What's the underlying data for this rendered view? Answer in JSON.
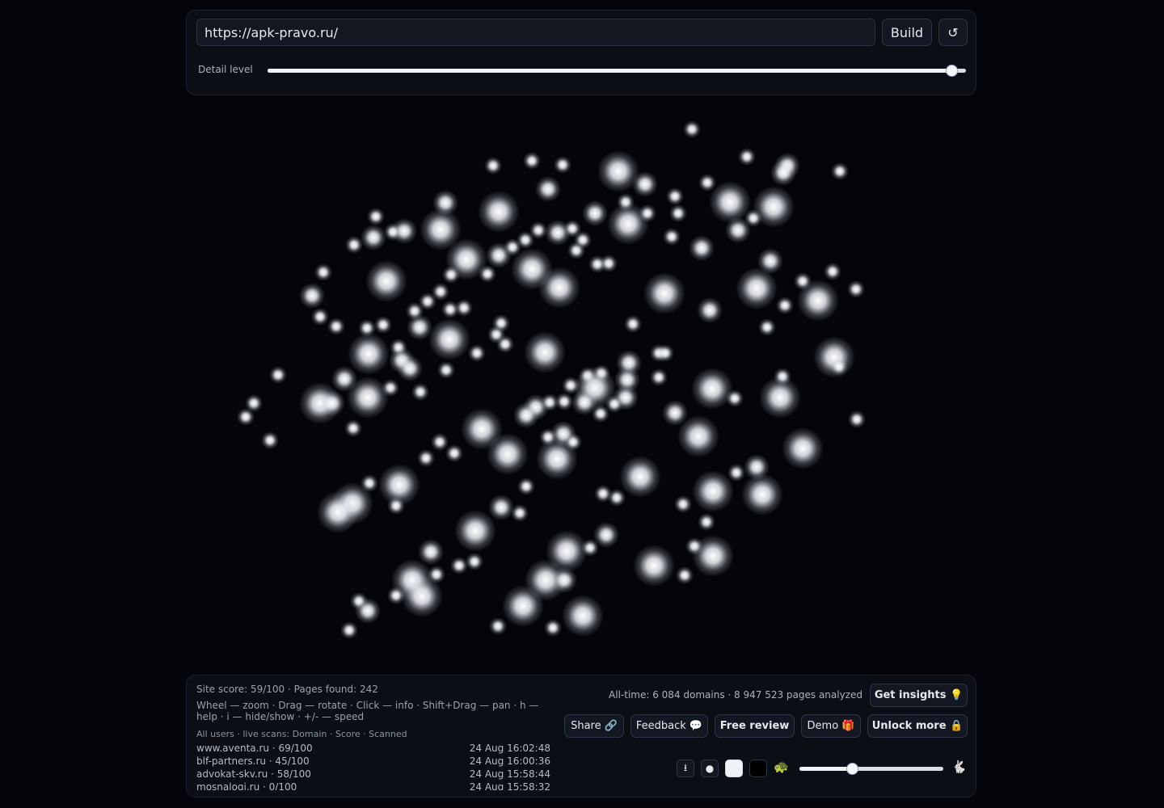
{
  "toolbar": {
    "url_value": "https://apk-pravo.ru/",
    "build_label": "Build",
    "reset_icon": "↺",
    "detail_label": "Detail level",
    "detail_level": 0.98
  },
  "stats": {
    "site_score": "Site score: 59/100 · Pages found: 242",
    "help": "Wheel — zoom · Drag — rotate · Click — info · Shift+Drag — pan · h — help · i — hide/show · +/- — speed",
    "live_header": "All users · live scans: Domain · Score · Scanned",
    "alltime": "All-time: 6 084 domains · 8 947 523 pages analyzed"
  },
  "live_scans": [
    {
      "domain": "www.aventa.ru · 69/100",
      "time": "24 Aug 16:02:48"
    },
    {
      "domain": "blf-partners.ru · 45/100",
      "time": "24 Aug 16:00:36"
    },
    {
      "domain": "advokat-skv.ru · 58/100",
      "time": "24 Aug 15:58:44"
    },
    {
      "domain": "mosnalogi.ru · 0/100",
      "time": "24 Aug 15:58:32"
    }
  ],
  "actions": {
    "insights": "Get insights 💡",
    "share": "Share 🔗",
    "feedback": "Feedback 💬",
    "review": "Free review",
    "demo": "Demo 🎁",
    "unlock": "Unlock more 🔒"
  },
  "controls": {
    "download_icon": "⭳",
    "dot_icon": "●",
    "turtle_icon": "🐢",
    "rabbit_icon": "🐇",
    "speed_level": 0.37
  },
  "colors": {
    "background": "#03050a",
    "node": "#ffffff"
  }
}
